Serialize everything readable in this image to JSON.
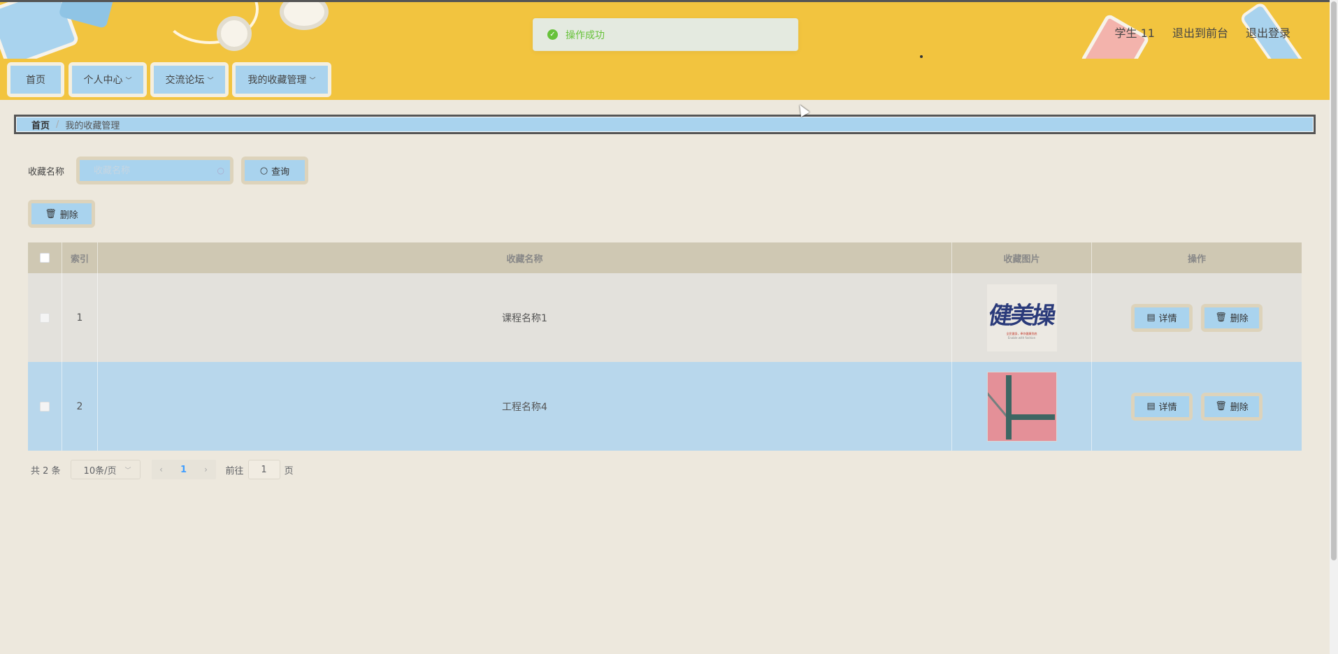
{
  "toast": {
    "message": "操作成功"
  },
  "topnav": {
    "user": "学生 11",
    "to_front": "退出到前台",
    "logout": "退出登录"
  },
  "menu": [
    {
      "label": "首页",
      "has_dropdown": false
    },
    {
      "label": "个人中心",
      "has_dropdown": true
    },
    {
      "label": "交流论坛",
      "has_dropdown": true
    },
    {
      "label": "我的收藏管理",
      "has_dropdown": true
    }
  ],
  "breadcrumb": {
    "home": "首页",
    "current": "我的收藏管理"
  },
  "search": {
    "label": "收藏名称",
    "placeholder": "收藏名称",
    "value": "",
    "button": "查询"
  },
  "actions": {
    "delete": "删除"
  },
  "table": {
    "headers": {
      "index": "索引",
      "name": "收藏名称",
      "image": "收藏图片",
      "ops": "操作"
    },
    "rows": [
      {
        "index": "1",
        "name": "课程名称1",
        "image": "jiancao-calligraphy",
        "detail": "详情",
        "delete": "删除"
      },
      {
        "index": "2",
        "name": "工程名称4",
        "image": "bracket-on-pink",
        "detail": "详情",
        "delete": "删除"
      }
    ],
    "thumb1": {
      "calligraphy": "健美操",
      "line1": "全民健身，奉你健康到底",
      "line2": "Enable with fashion"
    }
  },
  "pagination": {
    "total": "共 2 条",
    "page_size": "10条/页",
    "current_page": "1",
    "goto_prefix": "前往",
    "goto_value": "1",
    "goto_suffix": "页"
  },
  "colors": {
    "header_bg": "#f2c43f",
    "page_bg": "#ede8dd",
    "accent_blue": "#a9d3ee",
    "success": "#67c23a"
  }
}
